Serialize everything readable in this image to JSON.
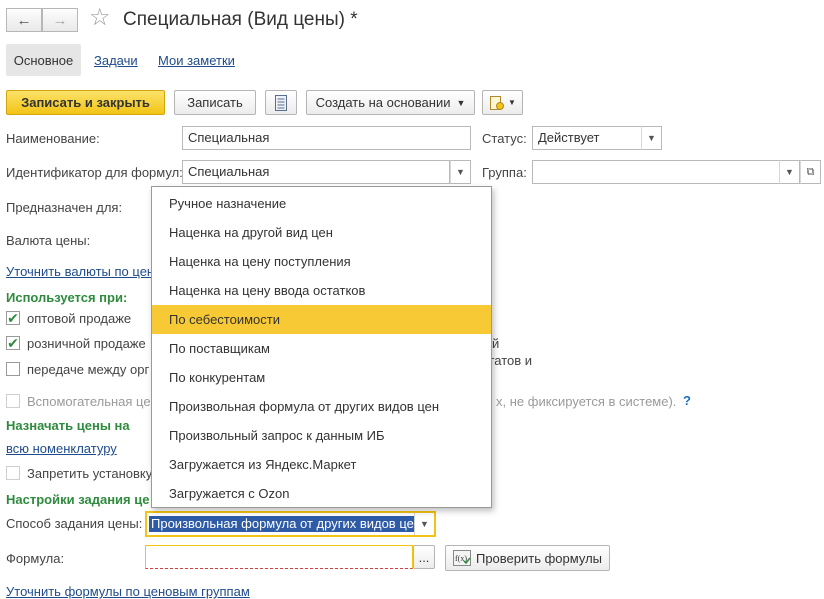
{
  "window": {
    "title": "Специальная (Вид цены) *"
  },
  "tabs": [
    {
      "label": "Основное",
      "active": true
    },
    {
      "label": "Задачи"
    },
    {
      "label": "Мои заметки"
    }
  ],
  "toolbar": {
    "save_close": "Записать и закрыть",
    "save": "Записать",
    "create_based": "Создать на основании"
  },
  "form": {
    "name_label": "Наименование:",
    "name_value": "Специальная",
    "status_label": "Статус:",
    "status_value": "Действует",
    "formula_id_label": "Идентификатор для формул:",
    "formula_id_value": "Специальная",
    "group_label": "Группа:",
    "group_value": "",
    "intended_label": "Предназначен для:",
    "currency_label": "Валюта цены:",
    "clarify_currency_link": "Уточнить валюты по цен",
    "used_when_title": "Используется при:",
    "wholesale_label": "оптовой продаже",
    "retail_label": "розничной продаже",
    "transfer_label": "передаче между орг",
    "right_frag1": "й",
    "right_frag2": "статов и",
    "auxiliary_label": "Вспомогательная це",
    "auxiliary_tail": "х, не фиксируется в системе).",
    "help_mark": "?",
    "assign_title": "Назначать цены на",
    "all_nomenclature_link": "всю номенклатуру",
    "forbid_label": "Запретить установку",
    "settings_title": "Настройки задания це",
    "price_method_label": "Способ задания цены:",
    "price_method_value": "Произвольная формула от других видов це",
    "formula_label": "Формула:",
    "formula_value": "",
    "ellipsis": "...",
    "check_formulas": "Проверить формулы",
    "clarify_formulas_link": "Уточнить формулы по ценовым группам"
  },
  "dropdown": {
    "items": [
      "Ручное назначение",
      "Наценка на другой вид цен",
      "Наценка на цену поступления",
      "Наценка на цену ввода остатков",
      "По себестоимости",
      "По поставщикам",
      "По конкурентам",
      "Произвольная формула от других видов цен",
      "Произвольный запрос к данным ИБ",
      "Загружается из Яндекс.Маркет",
      "Загружается с Ozon"
    ],
    "highlighted_index": 4
  },
  "colors": {
    "accent_yellow": "#f2c415",
    "section_green": "#2e8b3d",
    "link_blue": "#1e4b8b",
    "selection_blue": "#2d5ba8"
  }
}
